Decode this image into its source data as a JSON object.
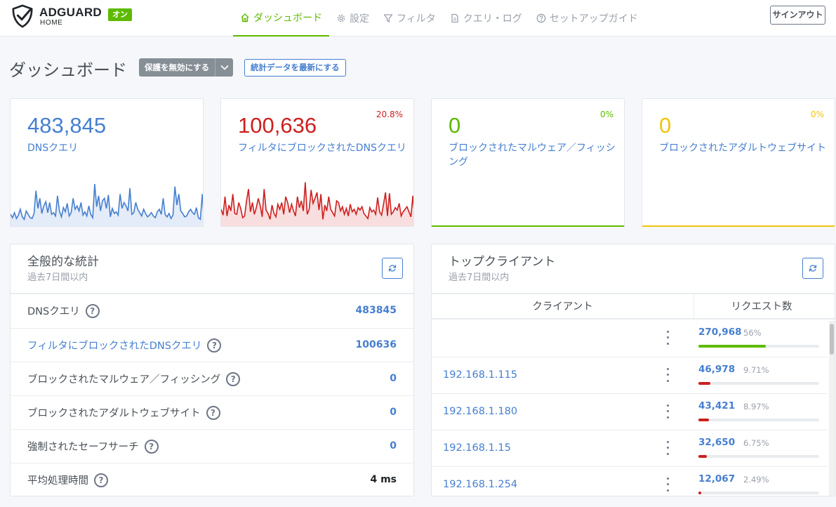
{
  "app": {
    "brand": "ADGUARD",
    "brand_sub": "HOME",
    "status_badge": "オン",
    "accent": "#5eba00",
    "link": "#467fcf",
    "danger": "#cd201f",
    "warning": "#f1c40f"
  },
  "nav": [
    {
      "label": "ダッシュボード",
      "icon": "home-icon",
      "active": true
    },
    {
      "label": "設定",
      "icon": "gear-icon",
      "active": false
    },
    {
      "label": "フィルタ",
      "icon": "filter-icon",
      "active": false
    },
    {
      "label": "クエリ・ログ",
      "icon": "document-icon",
      "active": false
    },
    {
      "label": "セットアップガイド",
      "icon": "help-circle-icon",
      "active": false
    }
  ],
  "signout_label": "サインアウト",
  "page": {
    "title": "ダッシュボード",
    "disable_protection_label": "保護を無効にする",
    "refresh_stats_label": "統計データを最新にする"
  },
  "cards": [
    {
      "value": "483,845",
      "label": "DNSクエリ",
      "percent": "",
      "color": "#467fcf"
    },
    {
      "value": "100,636",
      "label": "フィルタにブロックされたDNSクエリ",
      "percent": "20.8%",
      "color": "#cd201f"
    },
    {
      "value": "0",
      "label": "ブロックされたマルウェア／フィッシング",
      "percent": "0%",
      "color": "#5eba00"
    },
    {
      "value": "0",
      "label": "ブロックされたアダルトウェブサイト",
      "percent": "0%",
      "color": "#f1c40f"
    }
  ],
  "general": {
    "title": "全般的な統計",
    "subtitle": "過去7日間以内",
    "rows": [
      {
        "label": "DNSクエリ",
        "value": "483845",
        "label_link": false
      },
      {
        "label": "フィルタにブロックされたDNSクエリ",
        "value": "100636",
        "label_link": true
      },
      {
        "label": "ブロックされたマルウェア／フィッシング",
        "value": "0",
        "label_link": false
      },
      {
        "label": "ブロックされたアダルトウェブサイト",
        "value": "0",
        "label_link": false
      },
      {
        "label": "強制されたセーフサーチ",
        "value": "0",
        "label_link": false
      },
      {
        "label": "平均処理時間",
        "value": "4 ms",
        "label_link": false
      }
    ]
  },
  "clients": {
    "title": "トップクライアント",
    "subtitle": "過去7日間以内",
    "col_client": "クライアント",
    "col_requests": "リクエスト数",
    "rows": [
      {
        "ip": "",
        "count": "270,968",
        "percent": "56%",
        "fraction": 0.56,
        "color": "#5eba00"
      },
      {
        "ip": "192.168.1.115",
        "count": "46,978",
        "percent": "9.71%",
        "fraction": 0.0971,
        "color": "#cd201f"
      },
      {
        "ip": "192.168.1.180",
        "count": "43,421",
        "percent": "8.97%",
        "fraction": 0.0897,
        "color": "#cd201f"
      },
      {
        "ip": "192.168.1.15",
        "count": "32,650",
        "percent": "6.75%",
        "fraction": 0.0675,
        "color": "#cd201f"
      },
      {
        "ip": "192.168.1.254",
        "count": "12,067",
        "percent": "2.49%",
        "fraction": 0.0249,
        "color": "#cd201f"
      }
    ]
  },
  "sparklines": {
    "queries": [
      14,
      10,
      16,
      9,
      13,
      20,
      11,
      8,
      18,
      14,
      10,
      9,
      15,
      42,
      21,
      33,
      15,
      24,
      29,
      16,
      28,
      14,
      16,
      12,
      36,
      18,
      11,
      22,
      17,
      27,
      12,
      16,
      33,
      20,
      24,
      18,
      28,
      13,
      17,
      12,
      24,
      14,
      10,
      50,
      23,
      36,
      18,
      30,
      33,
      21,
      37,
      11,
      21,
      15,
      17,
      13,
      38,
      21,
      28,
      24,
      18,
      45,
      14,
      16,
      28,
      20,
      16,
      12,
      20,
      15,
      11,
      13,
      16,
      12,
      10,
      17,
      20,
      14,
      33,
      14,
      11,
      15,
      9,
      13,
      47,
      25,
      38,
      18,
      15,
      11,
      12,
      17,
      20,
      16,
      14,
      22,
      10,
      8,
      38,
      3
    ],
    "blocked": [
      20,
      13,
      35,
      12,
      25,
      18,
      38,
      15,
      14,
      28,
      21,
      10,
      12,
      30,
      44,
      17,
      28,
      14,
      22,
      33,
      24,
      11,
      44,
      19,
      15,
      8,
      25,
      15,
      11,
      26,
      20,
      28,
      14,
      35,
      28,
      16,
      26,
      18,
      12,
      35,
      22,
      30,
      18,
      52,
      14,
      20,
      43,
      27,
      33,
      40,
      19,
      38,
      8,
      25,
      18,
      35,
      20,
      16,
      12,
      30,
      28,
      18,
      23,
      14,
      21,
      12,
      26,
      17,
      20,
      14,
      22,
      19,
      23,
      15,
      12,
      9,
      22,
      17,
      19,
      14,
      34,
      17,
      13,
      26,
      40,
      12,
      39,
      14,
      17,
      22,
      19,
      27,
      12,
      17,
      20,
      23,
      17,
      11,
      36,
      9
    ]
  }
}
